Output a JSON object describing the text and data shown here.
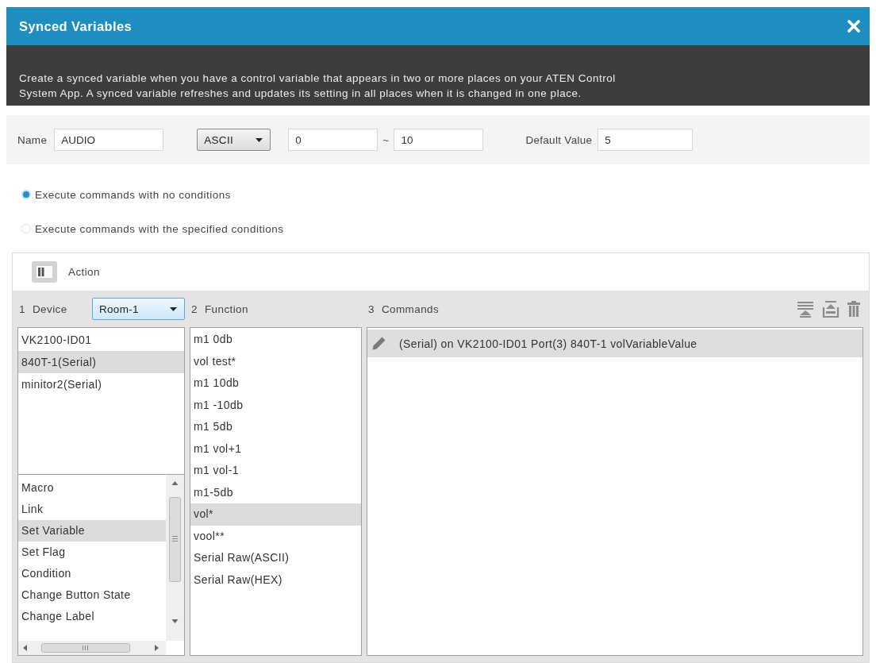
{
  "window": {
    "title": "Synced Variables"
  },
  "description": "Create a synced variable when you have a control variable that appears in two or more places on your ATEN Control System App. A synced variable refreshes and updates its setting in all places when it is changed in one place.",
  "variable": {
    "name_label": "Name",
    "name": "AUDIO",
    "format": "ASCII",
    "min": "0",
    "range_separator": "~",
    "max": "10",
    "default_label": "Default Value",
    "default_value": "5"
  },
  "conditions": [
    {
      "label": "Execute commands with no conditions",
      "selected": true
    },
    {
      "label": "Execute commands with the specified conditions",
      "selected": false
    }
  ],
  "action": {
    "title": "Action",
    "device": {
      "step": "1",
      "label": "Device",
      "room": "Room-1",
      "items": [
        {
          "label": "VK2100-ID01",
          "selected": false
        },
        {
          "label": "840T-1(Serial)",
          "selected": true
        },
        {
          "label": "minitor2(Serial)",
          "selected": false
        }
      ]
    },
    "action_types": [
      {
        "label": "Macro",
        "selected": false
      },
      {
        "label": "Link",
        "selected": false
      },
      {
        "label": "Set Variable",
        "selected": true
      },
      {
        "label": "Set Flag",
        "selected": false
      },
      {
        "label": "Condition",
        "selected": false
      },
      {
        "label": "Change Button State",
        "selected": false
      },
      {
        "label": "Change Label",
        "selected": false
      }
    ],
    "function": {
      "step": "2",
      "label": "Function",
      "items": [
        {
          "label": "m1 0db",
          "selected": false
        },
        {
          "label": "vol test*",
          "selected": false
        },
        {
          "label": "m1 10db",
          "selected": false
        },
        {
          "label": "m1 -10db",
          "selected": false
        },
        {
          "label": "m1 5db",
          "selected": false
        },
        {
          "label": "m1 vol+1",
          "selected": false
        },
        {
          "label": "m1 vol-1",
          "selected": false
        },
        {
          "label": "m1-5db",
          "selected": false
        },
        {
          "label": "vol*",
          "selected": true
        },
        {
          "label": "vool**",
          "selected": false
        },
        {
          "label": "Serial Raw(ASCII)",
          "selected": false
        },
        {
          "label": "Serial Raw(HEX)",
          "selected": false
        }
      ]
    },
    "commands": {
      "step": "3",
      "label": "Commands",
      "items": [
        {
          "text": "(Serial) on VK2100-ID01 Port(3) 840T-1 volVariableValue",
          "selected": true
        }
      ]
    }
  }
}
